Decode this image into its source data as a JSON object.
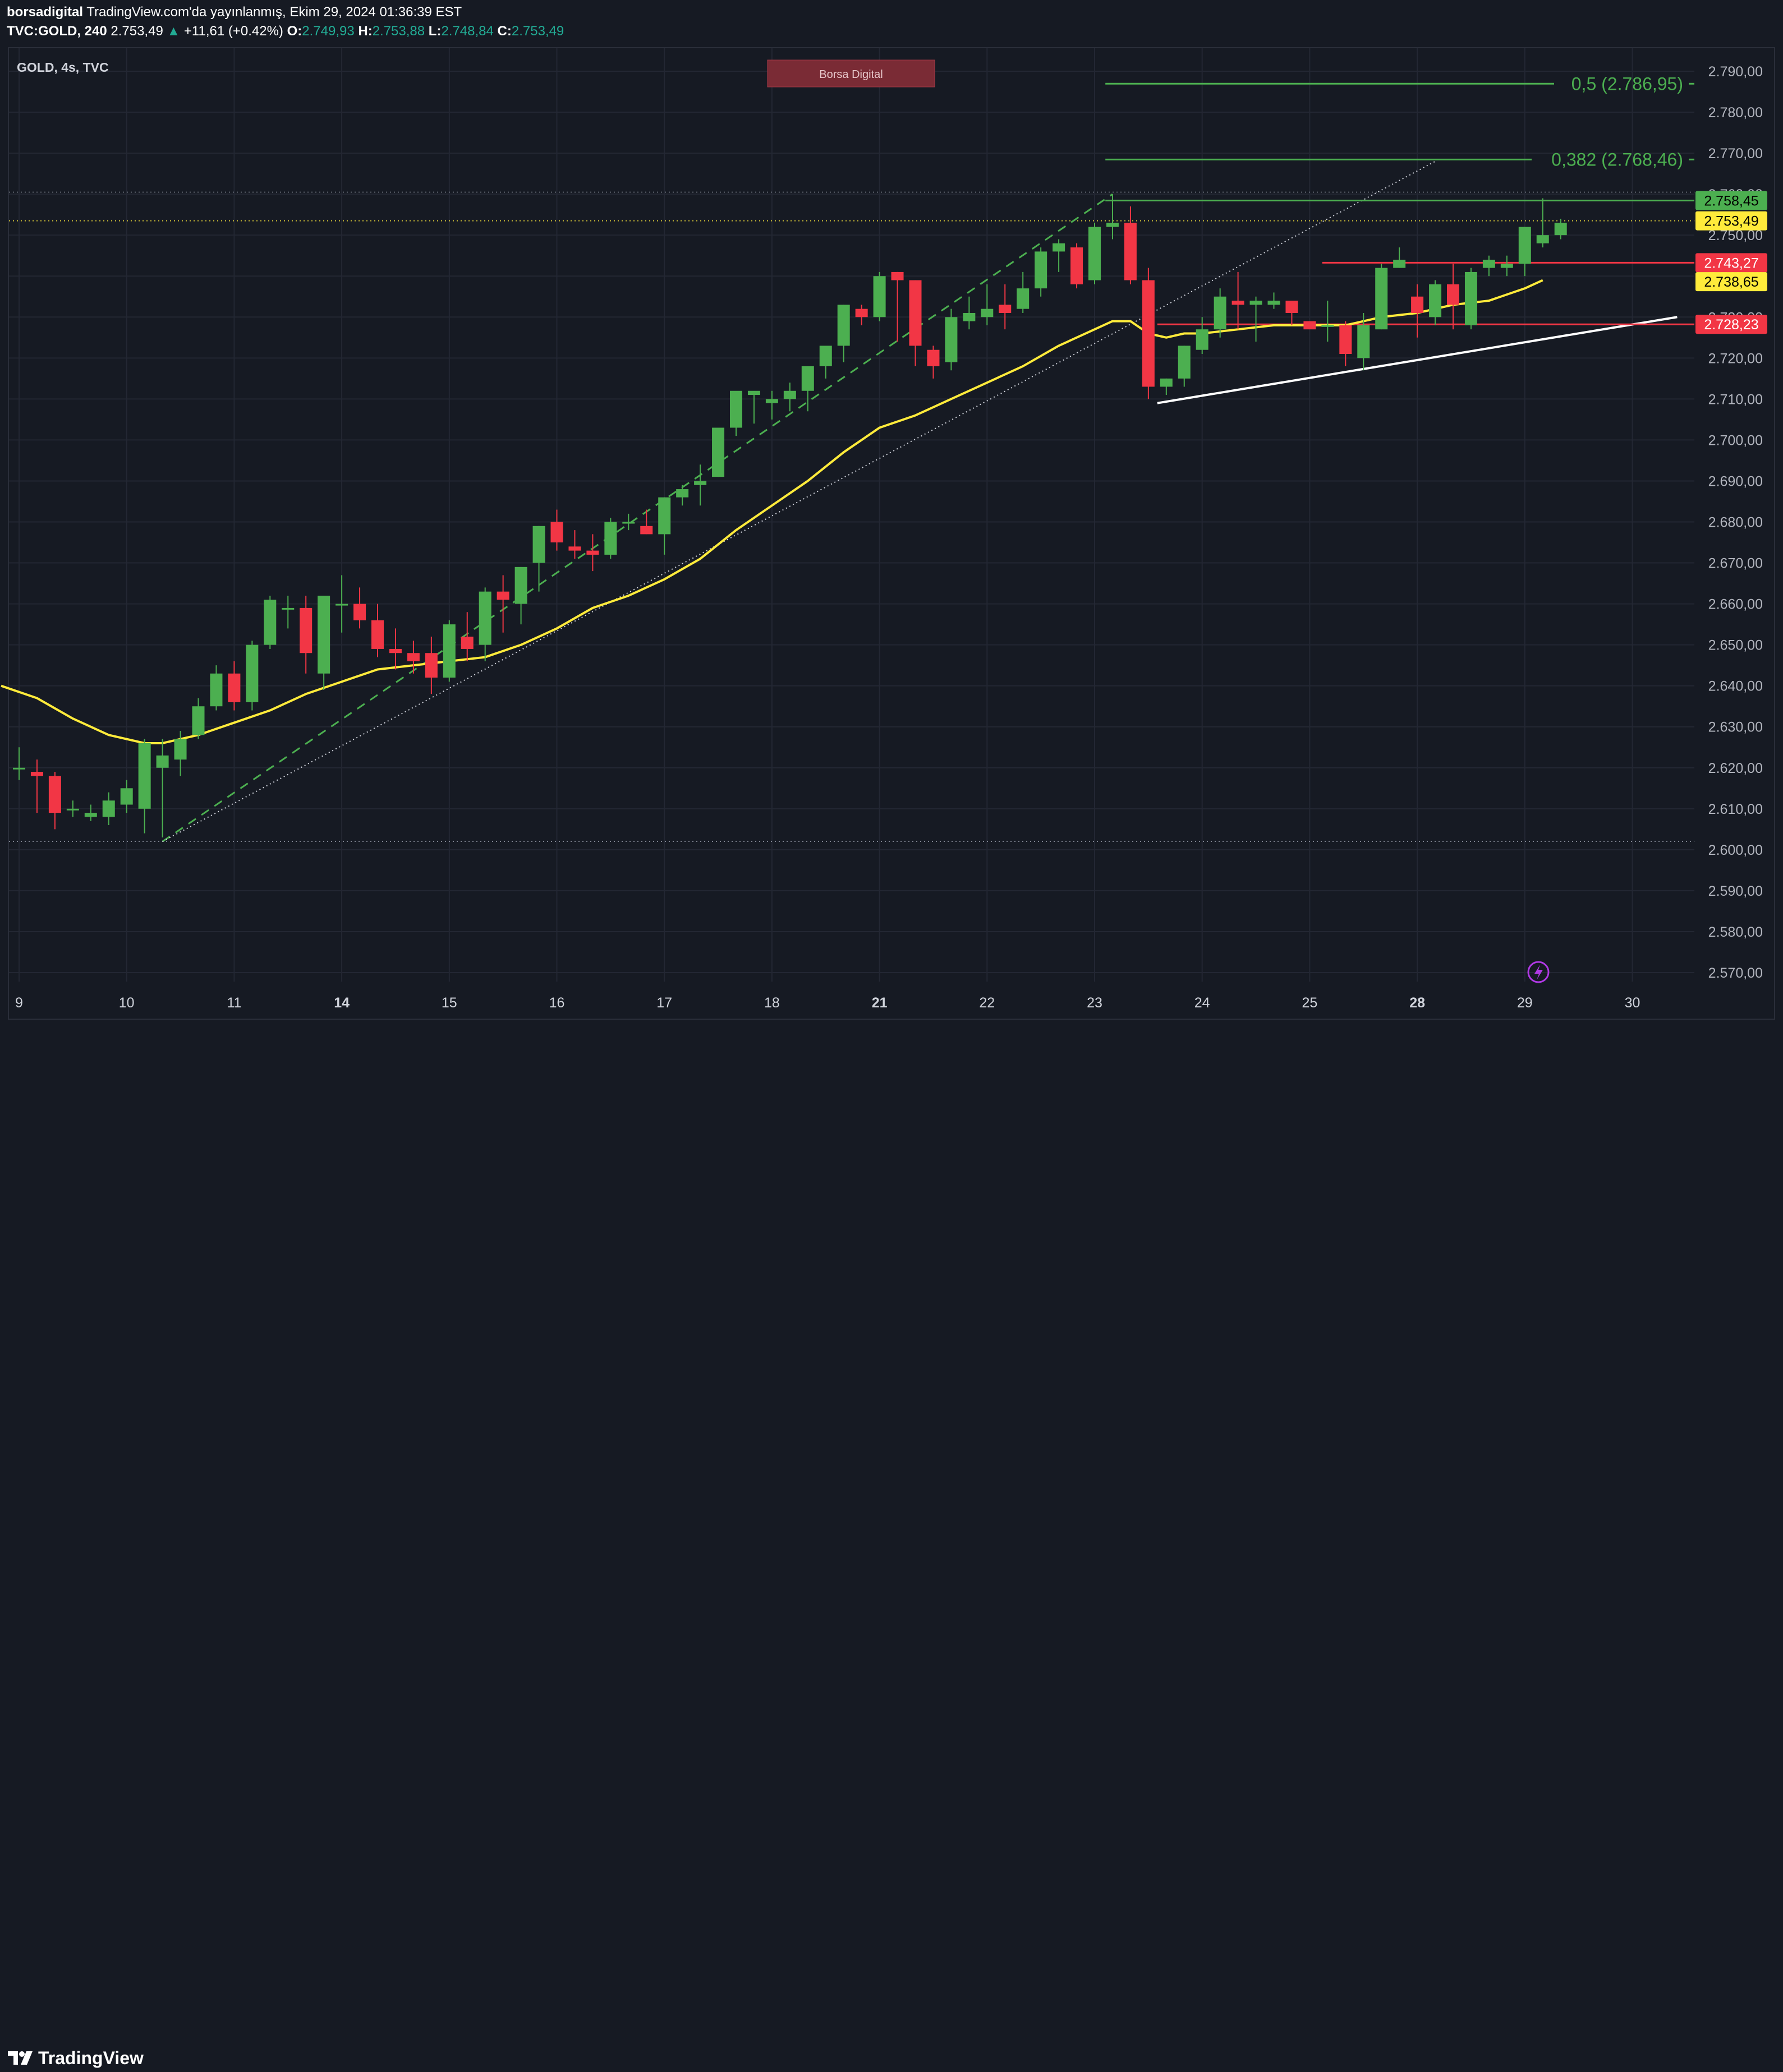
{
  "header": {
    "user": "borsadigital",
    "published": "TradingView.com'da yayınlanmış, Ekim 29, 2024 01:36:39 EST",
    "symbol": "TVC:GOLD, 240",
    "last": "2.753,49",
    "change": "+11,61 (+0.42%)",
    "o_label": "O:",
    "o": "2.749,93",
    "h_label": "H:",
    "h": "2.753,88",
    "l_label": "L:",
    "l": "2.748,84",
    "c_label": "C:",
    "c": "2.753,49"
  },
  "chart_title": "GOLD, 4s, TVC",
  "watermark": "Borsa Digital",
  "footer": {
    "brand": "TradingView"
  },
  "colors": {
    "up": "#4caf50",
    "down": "#f23645",
    "ma": "#ffeb3b",
    "fib": "#4caf50",
    "support": "#ffffff",
    "redline": "#f23645",
    "bg": "#161a23"
  },
  "chart_data": {
    "type": "candlestick",
    "title": "GOLD, 4s, TVC",
    "ylim": [
      2565,
      2795
    ],
    "y_ticks": [
      "2.570,00",
      "2.580,00",
      "2.590,00",
      "2.600,00",
      "2.610,00",
      "2.620,00",
      "2.630,00",
      "2.640,00",
      "2.650,00",
      "2.660,00",
      "2.670,00",
      "2.680,00",
      "2.690,00",
      "2.700,00",
      "2.710,00",
      "2.720,00",
      "2.730,00",
      "2.740,00",
      "2.750,00",
      "2.760,00",
      "2.770,00",
      "2.780,00",
      "2.790,00"
    ],
    "x_ticks": [
      {
        "label": "9",
        "x": 0,
        "bold": false
      },
      {
        "label": "10",
        "x": 6,
        "bold": false
      },
      {
        "label": "11",
        "x": 12,
        "bold": false
      },
      {
        "label": "14",
        "x": 18,
        "bold": true
      },
      {
        "label": "15",
        "x": 24,
        "bold": false
      },
      {
        "label": "16",
        "x": 30,
        "bold": false
      },
      {
        "label": "17",
        "x": 36,
        "bold": false
      },
      {
        "label": "18",
        "x": 42,
        "bold": false
      },
      {
        "label": "21",
        "x": 48,
        "bold": true
      },
      {
        "label": "22",
        "x": 54,
        "bold": false
      },
      {
        "label": "23",
        "x": 60,
        "bold": false
      },
      {
        "label": "24",
        "x": 66,
        "bold": false
      },
      {
        "label": "25",
        "x": 72,
        "bold": false
      },
      {
        "label": "28",
        "x": 78,
        "bold": true
      },
      {
        "label": "29",
        "x": 84,
        "bold": false
      },
      {
        "label": "30",
        "x": 90,
        "bold": false
      }
    ],
    "candles": [
      [
        2620,
        2625,
        2617,
        2620
      ],
      [
        2619,
        2622,
        2609,
        2618
      ],
      [
        2618,
        2619,
        2605,
        2609
      ],
      [
        2610,
        2612,
        2608,
        2610
      ],
      [
        2608,
        2611,
        2607,
        2609
      ],
      [
        2608,
        2614,
        2606,
        2612
      ],
      [
        2611,
        2617,
        2609,
        2615
      ],
      [
        2610,
        2627,
        2604,
        2626
      ],
      [
        2620,
        2627,
        2603,
        2623
      ],
      [
        2622,
        2629,
        2618,
        2627
      ],
      [
        2628,
        2637,
        2627,
        2635
      ],
      [
        2635,
        2645,
        2634,
        2643
      ],
      [
        2643,
        2646,
        2634,
        2636
      ],
      [
        2636,
        2651,
        2634,
        2650
      ],
      [
        2650,
        2662,
        2649,
        2661
      ],
      [
        2659,
        2662,
        2654,
        2659
      ],
      [
        2659,
        2662,
        2643,
        2648
      ],
      [
        2643,
        2661,
        2639,
        2662
      ],
      [
        2660,
        2667,
        2653,
        2660
      ],
      [
        2660,
        2664,
        2654,
        2656
      ],
      [
        2656,
        2660,
        2647,
        2649
      ],
      [
        2649,
        2654,
        2644,
        2648
      ],
      [
        2648,
        2651,
        2643,
        2646
      ],
      [
        2648,
        2652,
        2638,
        2642
      ],
      [
        2642,
        2656,
        2641,
        2655
      ],
      [
        2652,
        2658,
        2646,
        2649
      ],
      [
        2650,
        2664,
        2646,
        2663
      ],
      [
        2663,
        2667,
        2653,
        2661
      ],
      [
        2660,
        2669,
        2655,
        2669
      ],
      [
        2670,
        2679,
        2663,
        2679
      ],
      [
        2680,
        2683,
        2673,
        2675
      ],
      [
        2674,
        2678,
        2671,
        2673
      ],
      [
        2673,
        2677,
        2668,
        2672
      ],
      [
        2672,
        2681,
        2671,
        2680
      ],
      [
        2680,
        2682,
        2678,
        2680
      ],
      [
        2679,
        2683,
        2677,
        2677
      ],
      [
        2677,
        2686,
        2672,
        2686
      ],
      [
        2686,
        2689,
        2684,
        2688
      ],
      [
        2689,
        2694,
        2684,
        2690
      ],
      [
        2691,
        2702,
        2691,
        2703
      ],
      [
        2703,
        2711,
        2701,
        2712
      ],
      [
        2711,
        2711,
        2704,
        2712
      ],
      [
        2709,
        2712,
        2705,
        2710
      ],
      [
        2710,
        2714,
        2707,
        2712
      ],
      [
        2712,
        2717,
        2707,
        2718
      ],
      [
        2718,
        2720,
        2715,
        2723
      ],
      [
        2723,
        2733,
        2719,
        2733
      ],
      [
        2732,
        2733,
        2728,
        2730
      ],
      [
        2730,
        2741,
        2729,
        2740
      ],
      [
        2741,
        2741,
        2724,
        2739
      ],
      [
        2739,
        2739,
        2718,
        2723
      ],
      [
        2722,
        2723,
        2715,
        2718
      ],
      [
        2719,
        2732,
        2717,
        2730
      ],
      [
        2729,
        2735,
        2727,
        2731
      ],
      [
        2730,
        2738,
        2728,
        2732
      ],
      [
        2733,
        2738,
        2727,
        2731
      ],
      [
        2732,
        2741,
        2731,
        2737
      ],
      [
        2737,
        2747,
        2735,
        2746
      ],
      [
        2746,
        2749,
        2741,
        2748
      ],
      [
        2747,
        2748,
        2737,
        2738
      ],
      [
        2739,
        2753,
        2738,
        2752
      ],
      [
        2752,
        2760,
        2749,
        2753
      ],
      [
        2753,
        2757,
        2738,
        2739
      ],
      [
        2739,
        2742,
        2710,
        2713
      ],
      [
        2713,
        2715,
        2711,
        2715
      ],
      [
        2715,
        2723,
        2713,
        2723
      ],
      [
        2722,
        2730,
        2721,
        2727
      ],
      [
        2727,
        2737,
        2725,
        2735
      ],
      [
        2734,
        2741,
        2727,
        2733
      ],
      [
        2733,
        2735,
        2724,
        2734
      ],
      [
        2733,
        2736,
        2732,
        2734
      ],
      [
        2734,
        2734,
        2728,
        2731
      ],
      [
        2729,
        2729,
        2728,
        2727
      ],
      [
        2728,
        2734,
        2724,
        2728
      ],
      [
        2728,
        2729,
        2718,
        2721
      ],
      [
        2720,
        2731,
        2717,
        2728
      ],
      [
        2727,
        2743,
        2727,
        2742
      ],
      [
        2742,
        2747,
        2742,
        2744
      ],
      [
        2735,
        2738,
        2725,
        2731
      ],
      [
        2730,
        2739,
        2728,
        2738
      ],
      [
        2738,
        2743,
        2727,
        2733
      ],
      [
        2728,
        2742,
        2727,
        2741
      ],
      [
        2742,
        2745,
        2740,
        2744
      ],
      [
        2742,
        2745,
        2740,
        2743
      ],
      [
        2743,
        2752,
        2740,
        2752
      ],
      [
        2748,
        2759,
        2747,
        2750
      ],
      [
        2750,
        2754,
        2749,
        2753
      ]
    ],
    "moving_average": [
      [
        -1,
        2640
      ],
      [
        1,
        2637
      ],
      [
        3,
        2632
      ],
      [
        5,
        2628
      ],
      [
        7,
        2626
      ],
      [
        8,
        2626
      ],
      [
        10,
        2628
      ],
      [
        12,
        2631
      ],
      [
        14,
        2634
      ],
      [
        16,
        2638
      ],
      [
        18,
        2641
      ],
      [
        20,
        2644
      ],
      [
        22,
        2645
      ],
      [
        24,
        2646
      ],
      [
        26,
        2647
      ],
      [
        28,
        2650
      ],
      [
        30,
        2654
      ],
      [
        32,
        2659
      ],
      [
        34,
        2662
      ],
      [
        36,
        2666
      ],
      [
        38,
        2671
      ],
      [
        40,
        2678
      ],
      [
        42,
        2684
      ],
      [
        44,
        2690
      ],
      [
        46,
        2697
      ],
      [
        48,
        2703
      ],
      [
        50,
        2706
      ],
      [
        52,
        2710
      ],
      [
        54,
        2714
      ],
      [
        56,
        2718
      ],
      [
        58,
        2723
      ],
      [
        60,
        2727
      ],
      [
        61,
        2729
      ],
      [
        62,
        2729
      ],
      [
        63,
        2726
      ],
      [
        64,
        2725
      ],
      [
        65,
        2726
      ],
      [
        66,
        2726
      ],
      [
        68,
        2727
      ],
      [
        70,
        2728
      ],
      [
        72,
        2728
      ],
      [
        74,
        2728
      ],
      [
        76,
        2730
      ],
      [
        78,
        2731
      ],
      [
        80,
        2733
      ],
      [
        82,
        2734
      ],
      [
        84,
        2737
      ],
      [
        85,
        2739
      ]
    ],
    "fib_levels": [
      {
        "label": "0,5 (2.786,95)",
        "price": 2786.95
      },
      {
        "label": "0,382 (2.768,46)",
        "price": 2768.46
      },
      {
        "label": "",
        "price": 2758.45
      }
    ],
    "red_lines": [
      2743.27,
      2728.23
    ],
    "price_labels": [
      {
        "text": "2.758,45",
        "price": 2758.45,
        "bg": "#4caf50",
        "fg": "#000000"
      },
      {
        "text": "2.753,49",
        "price": 2753.49,
        "bg": "#ffeb3b",
        "fg": "#000000"
      },
      {
        "text": "2.743,27",
        "price": 2743.27,
        "bg": "#f23645",
        "fg": "#ffffff"
      },
      {
        "text": "2.738,65",
        "price": 2738.65,
        "bg": "#ffeb3b",
        "fg": "#000000"
      },
      {
        "text": "2.728,23",
        "price": 2728.23,
        "bg": "#f23645",
        "fg": "#ffffff"
      }
    ],
    "trendlines": [
      {
        "from": [
          8,
          2602
        ],
        "to": [
          61,
          2760
        ],
        "style": "dashed",
        "color": "#4caf50"
      },
      {
        "from": [
          8,
          2602
        ],
        "to": [
          79,
          2768
        ],
        "style": "dotted",
        "color": "#d1d4dc"
      },
      {
        "from": [
          63.5,
          2709
        ],
        "to": [
          92.5,
          2730
        ],
        "style": "solid",
        "color": "#ffffff"
      }
    ],
    "horizontal_dotted": [
      2760.5,
      2753.49,
      2602
    ]
  }
}
